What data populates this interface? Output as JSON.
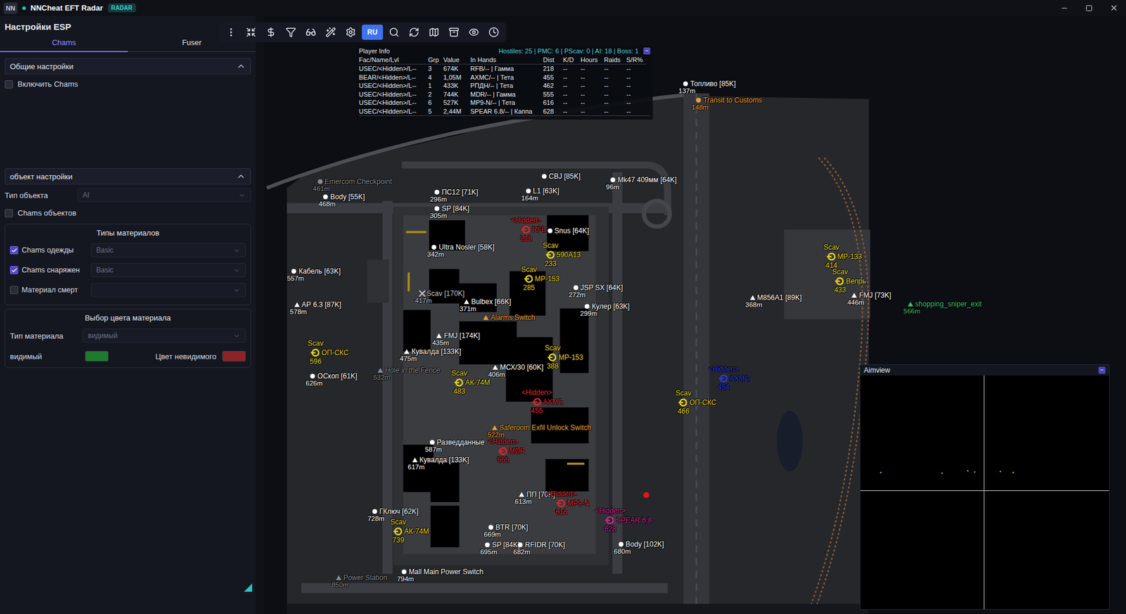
{
  "app": {
    "logo": "NN",
    "title": "NNCheat EFT Radar",
    "badge": "RADAR"
  },
  "esp_panel": {
    "title": "Настройки ESP",
    "tabs": [
      {
        "label": "Chams",
        "selected": true
      },
      {
        "label": "Fuser",
        "selected": false
      }
    ],
    "general": {
      "title": "Общие настройки",
      "expanded": true,
      "enable": {
        "label": "Включить Chams",
        "checked": false
      }
    },
    "object": {
      "title": "объект настройки",
      "expanded": true,
      "type_label": "Тип объекта",
      "type_value": "AI",
      "chams": {
        "label": "Chams объектов",
        "checked": false
      },
      "materials": {
        "title": "Типы материалов",
        "rows": [
          {
            "label": "Chams одежды",
            "checked": true,
            "value": "Basic"
          },
          {
            "label": "Chams снаряжен",
            "checked": true,
            "value": "Basic"
          },
          {
            "label": "Материал смерт",
            "checked": false,
            "value": ""
          }
        ]
      },
      "colors": {
        "title": "Выбор цвета материала",
        "type_label": "Тип материала",
        "type_value": "видимый",
        "visible_label": "видимый",
        "visible_color": "#1f7a2e",
        "invisible_label": "Цвет невидимого",
        "invisible_color": "#8b2424"
      }
    }
  },
  "toolbar": {
    "language": {
      "label": "RU",
      "selected": true
    }
  },
  "player_info": {
    "title": "Player Info",
    "summary": "Hostiles: 25 | PMC: 6 | PScav: 0 | AI: 18 | Boss: 1",
    "collapse": "−",
    "columns": [
      "Fac/Name/Lvl",
      "Grp",
      "Value",
      "In Hands",
      "Dist",
      "K/D",
      "Hours",
      "Raids",
      "S/R%"
    ],
    "rows": [
      [
        "USEC/<Hidden>/L--",
        "3",
        "674K",
        "RFB/-- | Гамма",
        "218",
        "--",
        "--",
        "--",
        "--"
      ],
      [
        "BEAR/<Hidden>/L--",
        "4",
        "1,05M",
        "AXMC/-- | Тета",
        "455",
        "--",
        "--",
        "--",
        "--"
      ],
      [
        "USEC/<Hidden>/L--",
        "1",
        "433K",
        "РПДН/-- | Тета",
        "462",
        "--",
        "--",
        "--",
        "--"
      ],
      [
        "USEC/<Hidden>/L--",
        "2",
        "744K",
        "MDR/-- | Гамма",
        "555",
        "--",
        "--",
        "--",
        "--"
      ],
      [
        "USEC/<Hidden>/L--",
        "6",
        "527K",
        "MP9-N/-- | Тета",
        "616",
        "--",
        "--",
        "--",
        "--"
      ],
      [
        "USEC/<Hidden>/L--",
        "5",
        "2,44M",
        "SPEAR 6.8/-- | Каппа",
        "628",
        "--",
        "--",
        "--",
        "--"
      ]
    ]
  },
  "map": {
    "markers": [
      {
        "kind": "dot",
        "label": "Топливо [85K]",
        "dist": "137m",
        "color": "#ffffff"
      },
      {
        "kind": "dot",
        "label": "Transit to Customs",
        "dist": "148m",
        "color": "#f0a030"
      },
      {
        "kind": "dot",
        "label": "Emercom Checkpoint",
        "dist": "461m",
        "color": "#8a8d93"
      },
      {
        "kind": "dot",
        "label": "Body [55K]",
        "dist": "468m",
        "color": "#ffffff"
      },
      {
        "kind": "dot",
        "label": "CBJ [85K]",
        "color": "#ffffff"
      },
      {
        "kind": "dot",
        "label": "L1 [63K]",
        "dist": "164m",
        "color": "#ffffff"
      },
      {
        "kind": "dot",
        "label": "Mk47 409мм [64K]",
        "dist": "96m",
        "color": "#ffffff"
      },
      {
        "kind": "dot",
        "label": "ПС12 [71K]",
        "dist": "296m",
        "color": "#ffffff"
      },
      {
        "kind": "dot",
        "label": "SP [84K]",
        "dist": "305m",
        "color": "#ffffff"
      },
      {
        "kind": "dot",
        "label": "Ultra Nosler [58K]",
        "dist": "342m",
        "color": "#ffffff"
      },
      {
        "kind": "pmc",
        "label": "<Hidden>",
        "sub": "RFB",
        "dist": "218",
        "color": "#e0242a"
      },
      {
        "kind": "dot",
        "label": "Snus [64K]",
        "color": "#ffffff"
      },
      {
        "kind": "scav",
        "label": "Scav",
        "sub": "590A13",
        "dist": "233",
        "color": "#e6d11c"
      },
      {
        "kind": "dot",
        "label": "Кабель [63K]",
        "dist": "557m",
        "color": "#ffffff"
      },
      {
        "kind": "triangle",
        "label": "АР 6.3 [87K]",
        "dist": "578m",
        "color": "#ffffff"
      },
      {
        "kind": "scav",
        "label": "Scav",
        "sub": "MP-153",
        "dist": "285",
        "color": "#e6d11c"
      },
      {
        "kind": "dot",
        "label": "JSP SX [64K]",
        "dist": "272m",
        "color": "#ffffff"
      },
      {
        "kind": "cross",
        "label": "Scav [170K]",
        "dist": "417m",
        "color": "#bfc2c8"
      },
      {
        "kind": "triangle",
        "label": "Bulbex [66K]",
        "dist": "371m",
        "color": "#ffffff"
      },
      {
        "kind": "dot",
        "label": "Кулер [63K]",
        "dist": "299m",
        "color": "#ffffff"
      },
      {
        "kind": "triangle",
        "label": "Alarms Switch",
        "color": "#f0a030"
      },
      {
        "kind": "triangle",
        "label": "FMJ [174K]",
        "dist": "435m",
        "color": "#ffffff"
      },
      {
        "kind": "triangle",
        "label": "Кувалда [133K]",
        "dist": "475m",
        "color": "#ffffff"
      },
      {
        "kind": "scav",
        "label": "Scav",
        "sub": "ОП-СКС",
        "dist": "596",
        "color": "#e6d11c"
      },
      {
        "kind": "dot",
        "label": "ОСкоп [61K]",
        "dist": "626m",
        "color": "#ffffff"
      },
      {
        "kind": "triangle",
        "label": "Hole in the Fence",
        "dist": "532m",
        "color": "#8a8d93"
      },
      {
        "kind": "scav",
        "label": "Scav",
        "sub": "MP-153",
        "dist": "388",
        "color": "#e6d11c"
      },
      {
        "kind": "triangle",
        "label": "МСХ/30 [60K]",
        "dist": "406m",
        "color": "#ffffff"
      },
      {
        "kind": "scav",
        "label": "Scav",
        "sub": "АК-74М",
        "dist": "483",
        "color": "#e6d11c"
      },
      {
        "kind": "pmc",
        "label": "<Hidden>",
        "sub": "AXMC",
        "dist": "455",
        "color": "#e0242a"
      },
      {
        "kind": "triangle",
        "label": "Saferoom Exfil Unlock Switch",
        "dist": "522m",
        "color": "#f0a030"
      },
      {
        "kind": "dot",
        "label": "Разведданные",
        "dist": "587m",
        "color": "#ffffff"
      },
      {
        "kind": "pmc",
        "label": "<Hidden>",
        "sub": "MDR",
        "dist": "555",
        "color": "#e0242a"
      },
      {
        "kind": "triangle",
        "label": "Кувалда [133K]",
        "dist": "617m",
        "color": "#ffffff"
      },
      {
        "kind": "triangle",
        "label": "ПП [70K]",
        "dist": "613m",
        "color": "#ffffff"
      },
      {
        "kind": "pmc",
        "label": "<Hidden>",
        "sub": "MP9-N",
        "dist": "616",
        "color": "#e0242a"
      },
      {
        "kind": "pmc",
        "label": "<Hidden>",
        "sub": "SPEAR 6.8",
        "dist": "628",
        "color": "#d0248c"
      },
      {
        "kind": "spot",
        "color": "#e8141c"
      },
      {
        "kind": "dot",
        "label": "BTR [70K]",
        "dist": "669m",
        "color": "#ffffff"
      },
      {
        "kind": "dot",
        "label": "SP [84K]",
        "dist": "695m",
        "color": "#ffffff"
      },
      {
        "kind": "dot",
        "label": "RFIDR [70K]",
        "dist": "682m",
        "color": "#ffffff"
      },
      {
        "kind": "dot",
        "label": "Body [102K]",
        "dist": "680m",
        "color": "#ffffff"
      },
      {
        "kind": "dot",
        "label": "ГКлюч [62K]",
        "dist": "728m",
        "color": "#ffffff"
      },
      {
        "kind": "scav",
        "label": "Scav",
        "sub": "АК-74М",
        "dist": "739",
        "color": "#e6d11c"
      },
      {
        "kind": "dot",
        "label": "Mall Main Power Switch",
        "dist": "794m",
        "color": "#ffffff"
      },
      {
        "kind": "triangle",
        "label": "Power Station",
        "dist": "850m",
        "color": "#8a8d93"
      },
      {
        "kind": "scav",
        "label": "Scav",
        "sub": "ОП-СКС",
        "dist": "466",
        "color": "#e6d11c"
      },
      {
        "kind": "friend",
        "label": "<Hidden>",
        "sub": "AXMC",
        "dist": "454",
        "color": "#2a38e0"
      },
      {
        "kind": "triangle",
        "label": "shopping_sniper_exit",
        "dist": "566m",
        "color": "#3fbf6a"
      },
      {
        "kind": "scav",
        "label": "Scav",
        "sub": "MP-133",
        "dist": "414",
        "color": "#e6d11c"
      },
      {
        "kind": "scav",
        "label": "Scav",
        "sub": "Вепрь",
        "dist": "433",
        "color": "#e6d11c"
      },
      {
        "kind": "triangle",
        "label": "M856A1 [89K]",
        "dist": "368m",
        "color": "#ffffff"
      },
      {
        "kind": "triangle",
        "label": "FMJ [73K]",
        "dist": "446m",
        "color": "#ffffff"
      }
    ]
  },
  "aimview": {
    "title": "Aimview",
    "collapse": "−"
  }
}
